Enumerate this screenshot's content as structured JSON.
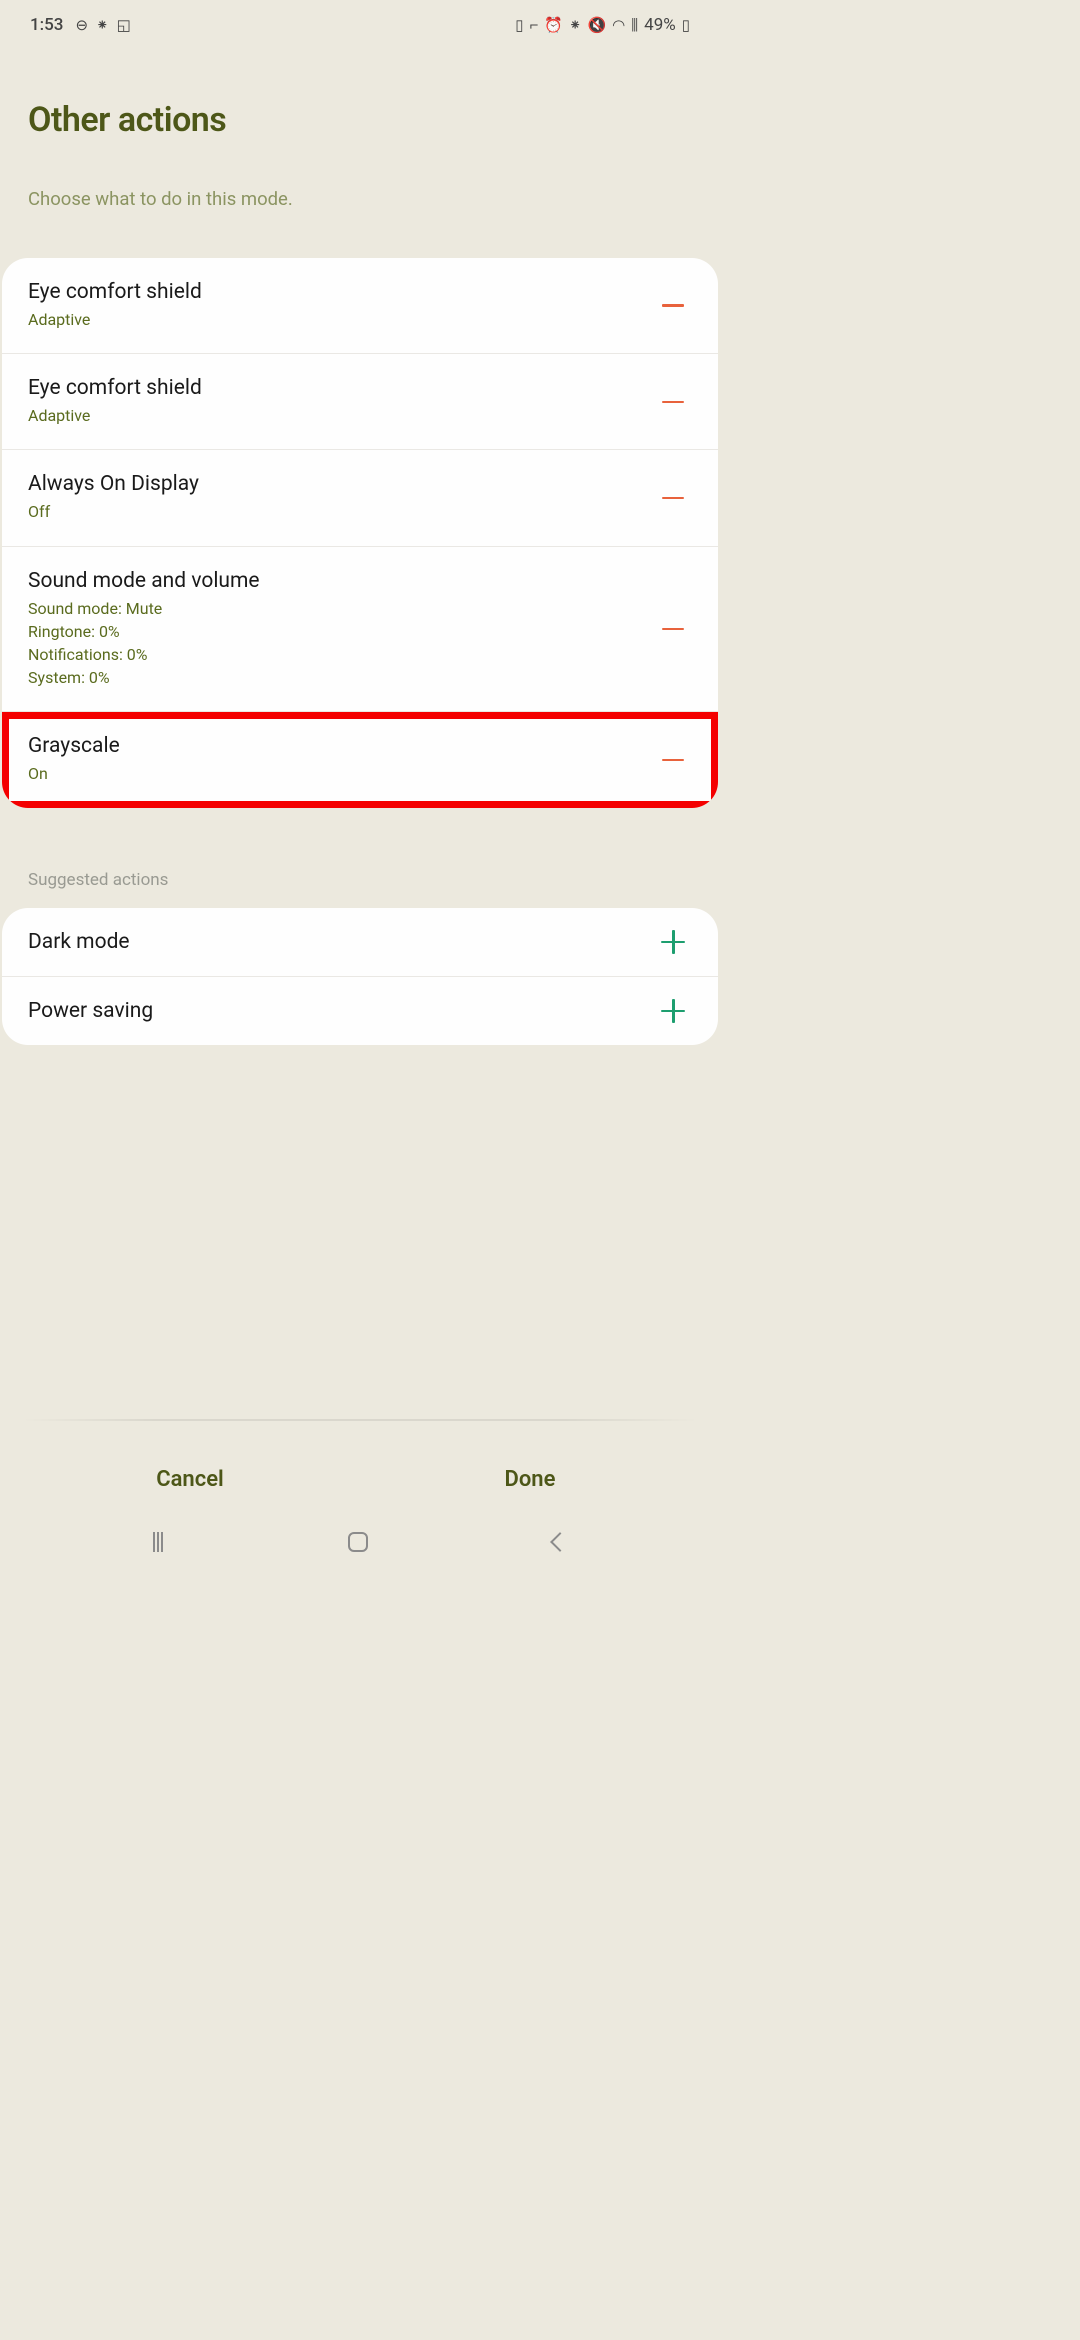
{
  "status": {
    "time": "1:53",
    "battery_pct": "49%"
  },
  "header": {
    "title": "Other actions",
    "subtitle": "Choose what to do in this mode."
  },
  "actions": [
    {
      "title": "Eye comfort shield",
      "sub": [
        "Adaptive"
      ],
      "op": "remove"
    },
    {
      "title": "Eye comfort shield",
      "sub": [
        "Adaptive"
      ],
      "op": "remove"
    },
    {
      "title": "Always On Display",
      "sub": [
        "Off"
      ],
      "op": "remove"
    },
    {
      "title": "Sound mode and volume",
      "sub": [
        "Sound mode: Mute",
        "Ringtone: 0%",
        "Notifications: 0%",
        "System: 0%"
      ],
      "op": "remove"
    },
    {
      "title": "Grayscale",
      "sub": [
        "On"
      ],
      "op": "remove",
      "highlighted": true
    }
  ],
  "suggested": {
    "label": "Suggested actions",
    "items": [
      {
        "title": "Dark mode",
        "op": "add"
      },
      {
        "title": "Power saving",
        "op": "add"
      }
    ]
  },
  "footer": {
    "cancel": "Cancel",
    "done": "Done"
  }
}
